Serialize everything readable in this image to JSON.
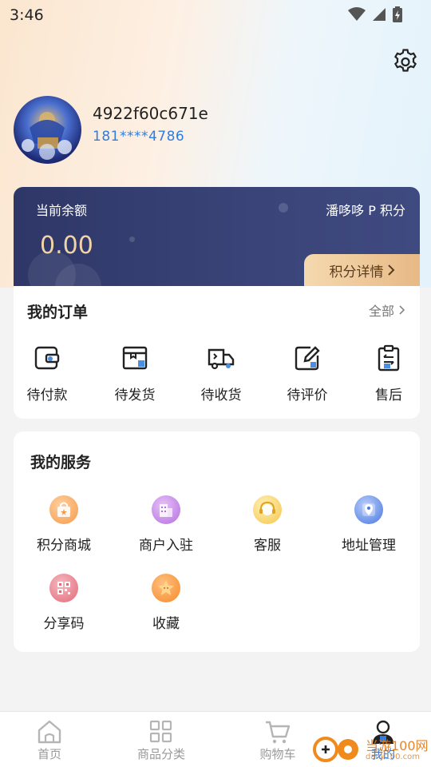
{
  "status_bar": {
    "time": "3:46"
  },
  "profile": {
    "username": "4922f60c671e",
    "phone": "181****4786"
  },
  "balance_card": {
    "balance_label": "当前余额",
    "balance_value": "0.00",
    "points_label": "潘哆哆 P 积分",
    "points_detail_label": "积分详情"
  },
  "orders": {
    "title": "我的订单",
    "all_label": "全部",
    "items": [
      {
        "label": "待付款",
        "icon": "wallet-icon"
      },
      {
        "label": "待发货",
        "icon": "package-box-icon"
      },
      {
        "label": "待收货",
        "icon": "delivery-truck-icon"
      },
      {
        "label": "待评价",
        "icon": "edit-review-icon"
      },
      {
        "label": "售后",
        "icon": "clipboard-return-icon"
      }
    ]
  },
  "services": {
    "title": "我的服务",
    "items": [
      {
        "label": "积分商城",
        "icon": "shopping-bag-icon",
        "color": "#f59a4a"
      },
      {
        "label": "商户入驻",
        "icon": "building-icon",
        "color": "#b56ee0"
      },
      {
        "label": "客服",
        "icon": "customer-service-icon",
        "color": "#f5c64a"
      },
      {
        "label": "地址管理",
        "icon": "location-pin-icon",
        "color": "#4a78e0"
      },
      {
        "label": "分享码",
        "icon": "qr-code-icon",
        "color": "#e06a78"
      },
      {
        "label": "收藏",
        "icon": "star-icon",
        "color": "#f58a2a"
      }
    ]
  },
  "tab_bar": {
    "tabs": [
      {
        "label": "首页",
        "icon": "home-icon",
        "active": false
      },
      {
        "label": "商品分类",
        "icon": "grid-icon",
        "active": false
      },
      {
        "label": "购物车",
        "icon": "cart-icon",
        "active": false
      },
      {
        "label": "我的",
        "icon": "user-icon",
        "active": true
      }
    ]
  },
  "watermark": {
    "text": "当游100网",
    "sub": "danji100.com"
  },
  "colors": {
    "accent": "#2f7de1",
    "card_dark": "#2e3767",
    "gold": "#e7b985"
  }
}
